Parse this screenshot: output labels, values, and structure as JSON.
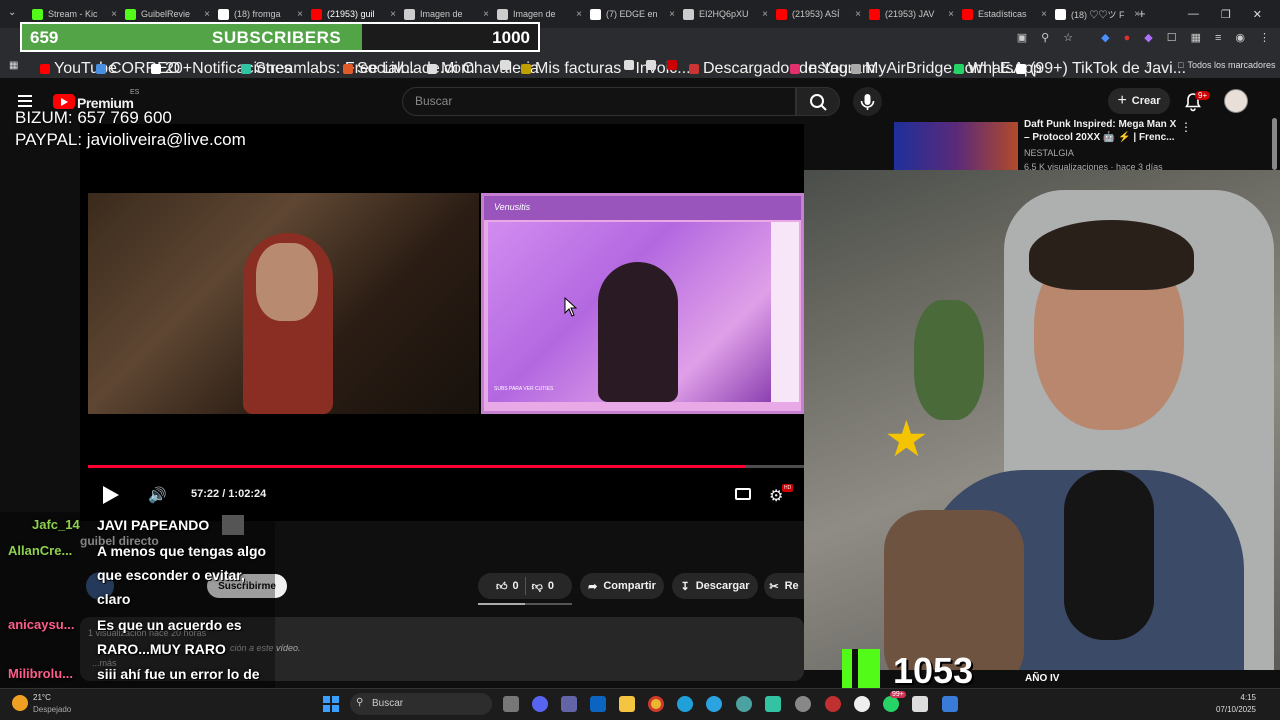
{
  "browser": {
    "tabs": [
      {
        "title": "Stream - Kic",
        "icon": "kick-icon",
        "color": "#53fc18"
      },
      {
        "title": "GuibelRevie",
        "icon": "kick-icon",
        "color": "#53fc18"
      },
      {
        "title": "(18) fromga",
        "icon": "x-icon",
        "color": "#ffffff"
      },
      {
        "title": "(21953) guil",
        "icon": "youtube-icon",
        "color": "#ff0000"
      },
      {
        "title": "Imagen de",
        "icon": "globe-icon",
        "color": "#cccccc"
      },
      {
        "title": "Imagen de",
        "icon": "globe-icon",
        "color": "#cccccc"
      },
      {
        "title": "(7) EDGE en",
        "icon": "x-icon",
        "color": "#ffffff"
      },
      {
        "title": "EI2HQ6pXU",
        "icon": "globe-icon",
        "color": "#cccccc"
      },
      {
        "title": "(21953) ASÍ",
        "icon": "youtube-icon",
        "color": "#ff0000"
      },
      {
        "title": "(21953) JAV",
        "icon": "youtube-icon",
        "color": "#ff0000"
      },
      {
        "title": "Estadísticas",
        "icon": "youtube-icon",
        "color": "#ff0000"
      },
      {
        "title": "(18) ♡♡ツ F",
        "icon": "x-icon",
        "color": "#ffffff"
      }
    ],
    "bookmarks": [
      {
        "label": "YouTube",
        "color": "#ff0000"
      },
      {
        "label": "CORREO",
        "color": "#4a90e2"
      },
      {
        "label": "20+Notificaciones",
        "color": "#ffffff"
      },
      {
        "label": "Streamlabs: Free Liv...",
        "color": "#31c3a2"
      },
      {
        "label": "Socialblade.com",
        "color": "#e05a2a"
      },
      {
        "label": "Mi Chavaleria",
        "color": "#dddddd"
      },
      {
        "label": "",
        "color": "#dddddd"
      },
      {
        "label": "Mis facturas - Invoic...",
        "color": "#c0a000"
      },
      {
        "label": "",
        "color": "#dddddd"
      },
      {
        "label": "",
        "color": "#dddddd"
      },
      {
        "label": "",
        "color": "#cc0000"
      },
      {
        "label": "Descargador de You...",
        "color": "#cc3333"
      },
      {
        "label": "Instagram",
        "color": "#e1306c"
      },
      {
        "label": "MyAirBridge.com | E...",
        "color": "#aaaaaa"
      },
      {
        "label": "WhatsApp",
        "color": "#25d366"
      },
      {
        "label": "(99+) TikTok de Javi...",
        "color": "#ffffff"
      }
    ],
    "all_bookmarks": "Todos los marcadores"
  },
  "subscriber_goal": {
    "current": "659",
    "label": "SUBSCRIBERS",
    "goal": "1000",
    "progress": 0.659,
    "fill_color": "#52a447"
  },
  "youtube": {
    "brand": "Premium",
    "country": "ES",
    "search_placeholder": "Buscar",
    "create_label": "Crear",
    "notifications": "9+"
  },
  "donation": {
    "bizum": "BIZUM: 657 769 600",
    "paypal": "PAYPAL: javioliveira@live.com"
  },
  "player": {
    "time": "57:22 / 1:02:24",
    "progress": 0.919,
    "cam_title": "Venusitis",
    "cam_caption": "SUBS PARA VER CUTIES"
  },
  "video": {
    "channel": "guibel directo",
    "subscribe_label": "Suscribirme",
    "likes": "0",
    "dislikes": "0",
    "share_label": "Compartir",
    "download_label": "Descargar",
    "clip_label": "Re",
    "views": "1 visualización  hace 20 horas",
    "description": "ción a este vídeo.",
    "more": "...más"
  },
  "chat": [
    {
      "user": "Jafc_14",
      "color": "#8fd14f",
      "message": "JAVI PAPEANDO"
    },
    {
      "user": "AllanCre...",
      "color": "#8fd14f",
      "message": "A menos que tengas algo que esconder o evitar, claro"
    },
    {
      "user": "anicaysu...",
      "color": "#ff5c8a",
      "message": "Es que un acuerdo es RARO...MUY RARO"
    },
    {
      "user": "Milibrolu...",
      "color": "#ff5c8a",
      "message": "siii ahí fue un error lo de Michael Jackson"
    }
  ],
  "recommendation": {
    "title": "Daft Punk Inspired: Mega Man X – Protocol 20XX 🤖 ⚡ | Frenc...",
    "channel": "NESTALGIA",
    "meta": "6,5 K visualizaciones · hace 3 días"
  },
  "overlay": {
    "kick_count": "1053",
    "season": "AÑO IV"
  },
  "taskbar": {
    "temperature": "21°C",
    "weather": "Despejado",
    "search_label": "Buscar",
    "time": "4:15",
    "date": "07/10/2025",
    "whatsapp_badge": "99+"
  }
}
